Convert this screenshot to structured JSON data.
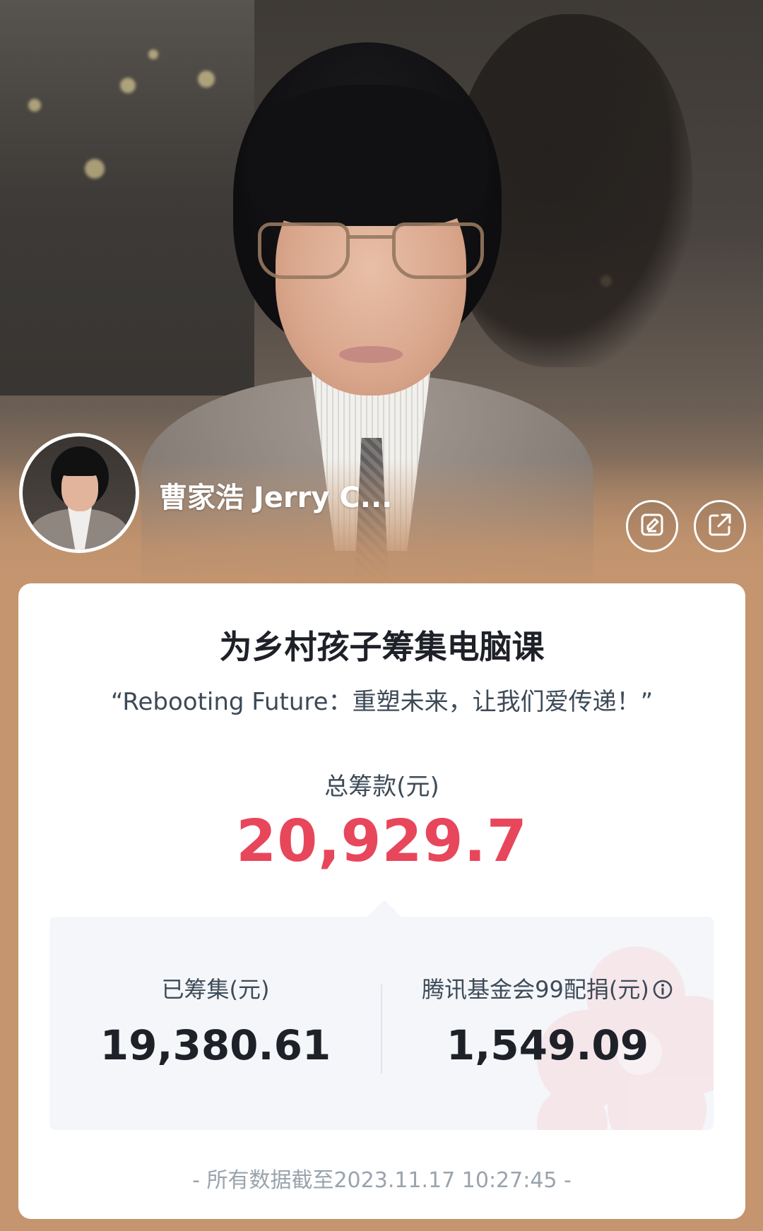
{
  "profile": {
    "name": "曹家浩 Jerry C..."
  },
  "actions": {
    "edit_icon": "edit-icon",
    "share_icon": "share-icon"
  },
  "project": {
    "title": "为乡村孩子筹集电脑课",
    "slogan": "“Rebooting Future：重塑未来，让我们爱传递！”"
  },
  "total": {
    "label": "总筹款(元)",
    "amount": "20,929.7"
  },
  "stats": {
    "raised_label": "已筹集(元)",
    "raised_value": "19,380.61",
    "match_label": "腾讯基金会99配捐(元)",
    "match_value": "1,549.09"
  },
  "footnote": "- 所有数据截至2023.11.17 10:27:45 -",
  "colors": {
    "accent_red": "#e8465b",
    "background": "#c4956f",
    "card": "#ffffff",
    "stats_panel": "#f4f6fa"
  }
}
